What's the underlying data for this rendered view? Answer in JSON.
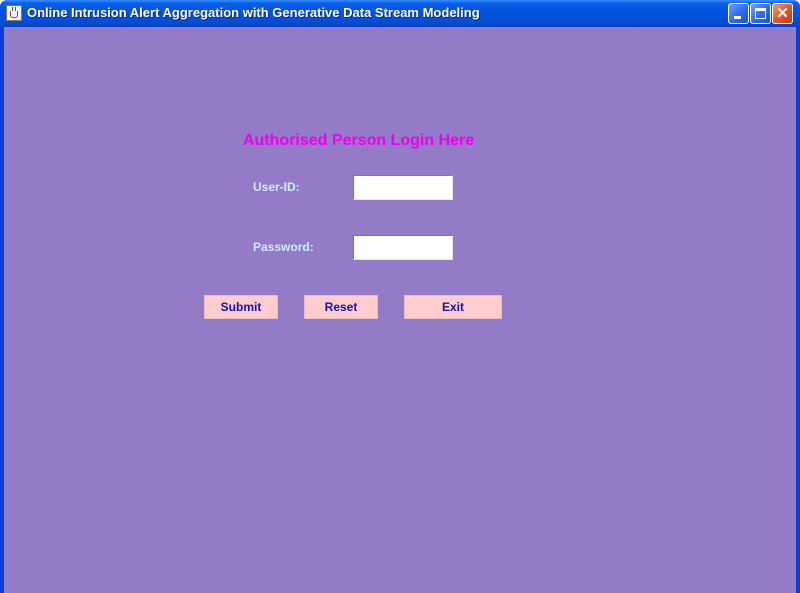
{
  "window": {
    "title": "Online Intrusion Alert Aggregation with Generative Data Stream Modeling",
    "icon": "java-cup-icon",
    "controls": {
      "minimize_icon": "minimize-icon",
      "maximize_icon": "maximize-icon",
      "close_icon": "close-icon",
      "close_glyph": "✕"
    }
  },
  "login": {
    "heading": "Authorised Person Login Here",
    "user_label": "User-ID:",
    "user_value": "",
    "password_label": "Password:",
    "password_value": ""
  },
  "buttons": {
    "submit": "Submit",
    "reset": "Reset",
    "exit": "Exit"
  },
  "colors": {
    "background": "#937bc8",
    "heading": "#f000f0",
    "label": "#c8f0ff",
    "button_bg": "#ffcdcd",
    "button_text": "#1010c8"
  }
}
